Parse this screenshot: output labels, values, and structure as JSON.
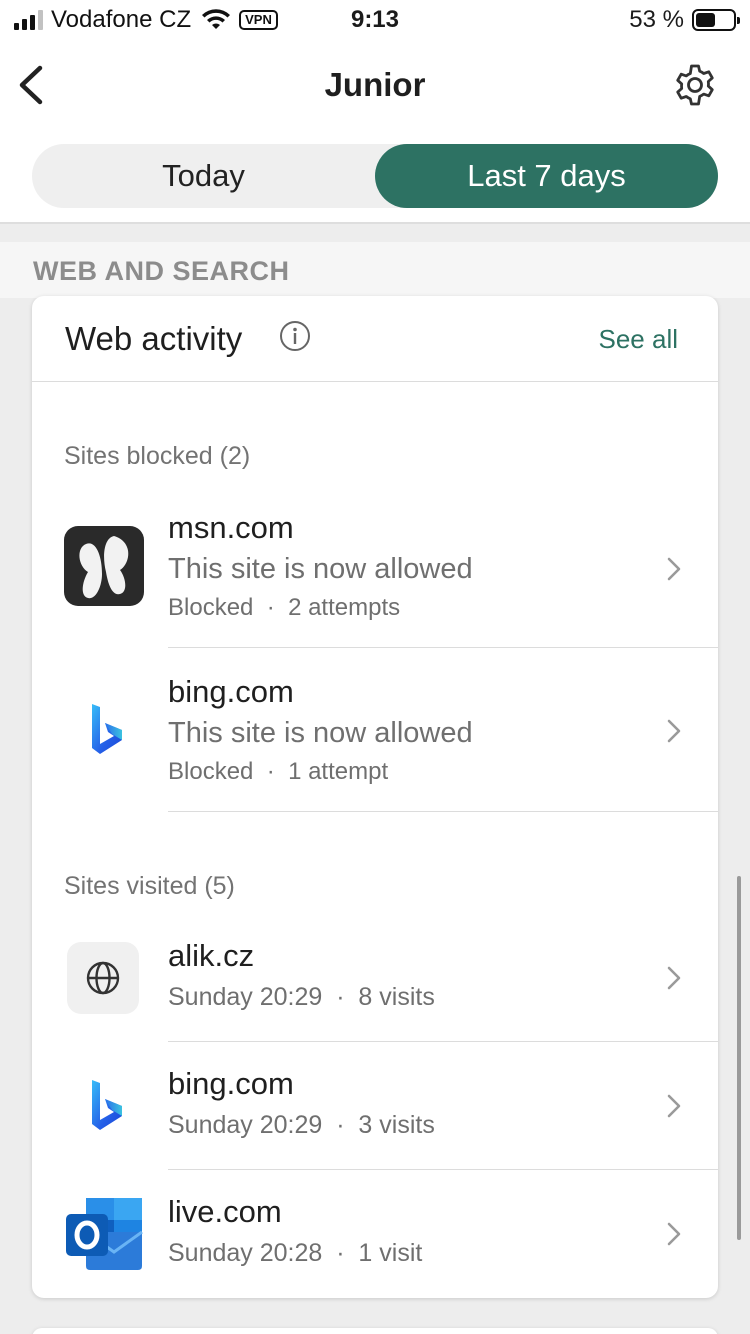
{
  "status_bar": {
    "carrier": "Vodafone CZ",
    "vpn": "VPN",
    "time": "9:13",
    "battery": "53 %",
    "battery_level": 0.53
  },
  "header": {
    "title": "Junior",
    "back_icon": "chevron-left-icon",
    "settings_icon": "gear-icon"
  },
  "tabs": [
    {
      "label": "Today",
      "active": false
    },
    {
      "label": "Last 7 days",
      "active": true
    }
  ],
  "section_title": "WEB AND SEARCH",
  "card": {
    "title": "Web activity",
    "see_all": "See all",
    "blocked": {
      "label": "Sites blocked (2)",
      "items": [
        {
          "name": "msn.com",
          "status": "This site is now allowed",
          "state": "Blocked",
          "count": "2 attempts",
          "icon": "msn-butterfly-icon"
        },
        {
          "name": "bing.com",
          "status": "This site is now allowed",
          "state": "Blocked",
          "count": "1 attempt",
          "icon": "bing-icon"
        }
      ]
    },
    "visited": {
      "label": "Sites visited (5)",
      "items": [
        {
          "name": "alik.cz",
          "time": "Sunday 20:29",
          "count": "8 visits",
          "icon": "globe-icon"
        },
        {
          "name": "bing.com",
          "time": "Sunday 20:29",
          "count": "3 visits",
          "icon": "bing-icon"
        },
        {
          "name": "live.com",
          "time": "Sunday 20:28",
          "count": "1 visit",
          "icon": "outlook-icon"
        }
      ]
    }
  },
  "colors": {
    "accent": "#2d7263",
    "background": "#ededed"
  }
}
